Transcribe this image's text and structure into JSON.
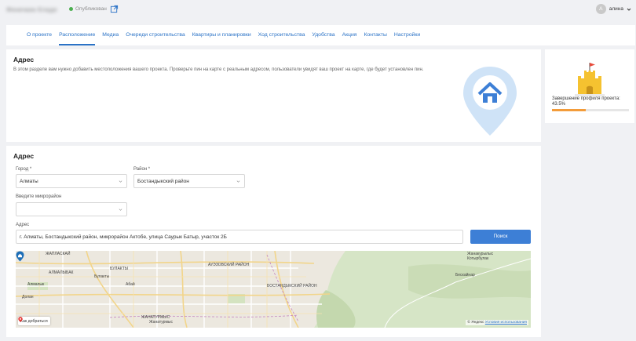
{
  "header": {
    "project_title": "Фенечкин Кладе",
    "status": "Опубликован",
    "user_initial": "А",
    "user_name": "алина"
  },
  "tabs": [
    {
      "label": "О проекте"
    },
    {
      "label": "Расположение"
    },
    {
      "label": "Медиа"
    },
    {
      "label": "Очереди строительства"
    },
    {
      "label": "Квартиры и планировки"
    },
    {
      "label": "Ход строительства"
    },
    {
      "label": "Удобства"
    },
    {
      "label": "Акция"
    },
    {
      "label": "Контакты"
    },
    {
      "label": "Настройки"
    }
  ],
  "active_tab": "Расположение",
  "info": {
    "title": "Адрес",
    "description": "В этом разделе вам нужно добавить местоположения вашего проекта. Проверьте пин на карте с реальным адресом, пользователи увидят ваш проект на карте, где будет установлен пин."
  },
  "profile": {
    "label": "Завершение профиля проекта:",
    "value": "43.5%",
    "progress": 0.435
  },
  "form": {
    "title": "Адрес",
    "city_label": "Город *",
    "city_value": "Алматы",
    "district_label": "Район *",
    "district_value": "Бостандыкский район",
    "micro_label": "Введите микрорайон",
    "micro_value": "",
    "address_label": "Адрес",
    "address_value": "г. Алматы, Бостандыкский район, микрорайон Актобе, улица Саурык Батыр, участок 2Б",
    "search_label": "Поиск"
  },
  "map": {
    "labels": {
      "zhaplaskai": "ЖАПЛАСКАЙ",
      "almalybak": "АЛМАЛЫБАК",
      "almalyk": "Алмалык",
      "bulakty": "БУЛАКТЫ",
      "bulakty2": "Булакты",
      "abai": "Абай",
      "auezov": "АУЭЗОВСКИЙ РАЙОН",
      "bostandyk": "БОСТАНДЫКСКИЙ РАЙОН",
      "dolan": "Долан",
      "zhanaturmys": "ЖАНАТУРМЫС",
      "zhanaturmys2": "Жанатурмыс",
      "beskainar": "Бескайнар",
      "zhanakurylys": "Жанакурылыс",
      "kotyrbulak": "Котырбулак"
    },
    "how_to_get": "Как добраться",
    "copyright_brand": "© Яндекс",
    "copyright_link": "Условия использования"
  },
  "colors": {
    "accent": "#2a72c6",
    "button": "#3d7fd6",
    "progress": "#f39c3a",
    "status_dot": "#4caf50"
  }
}
